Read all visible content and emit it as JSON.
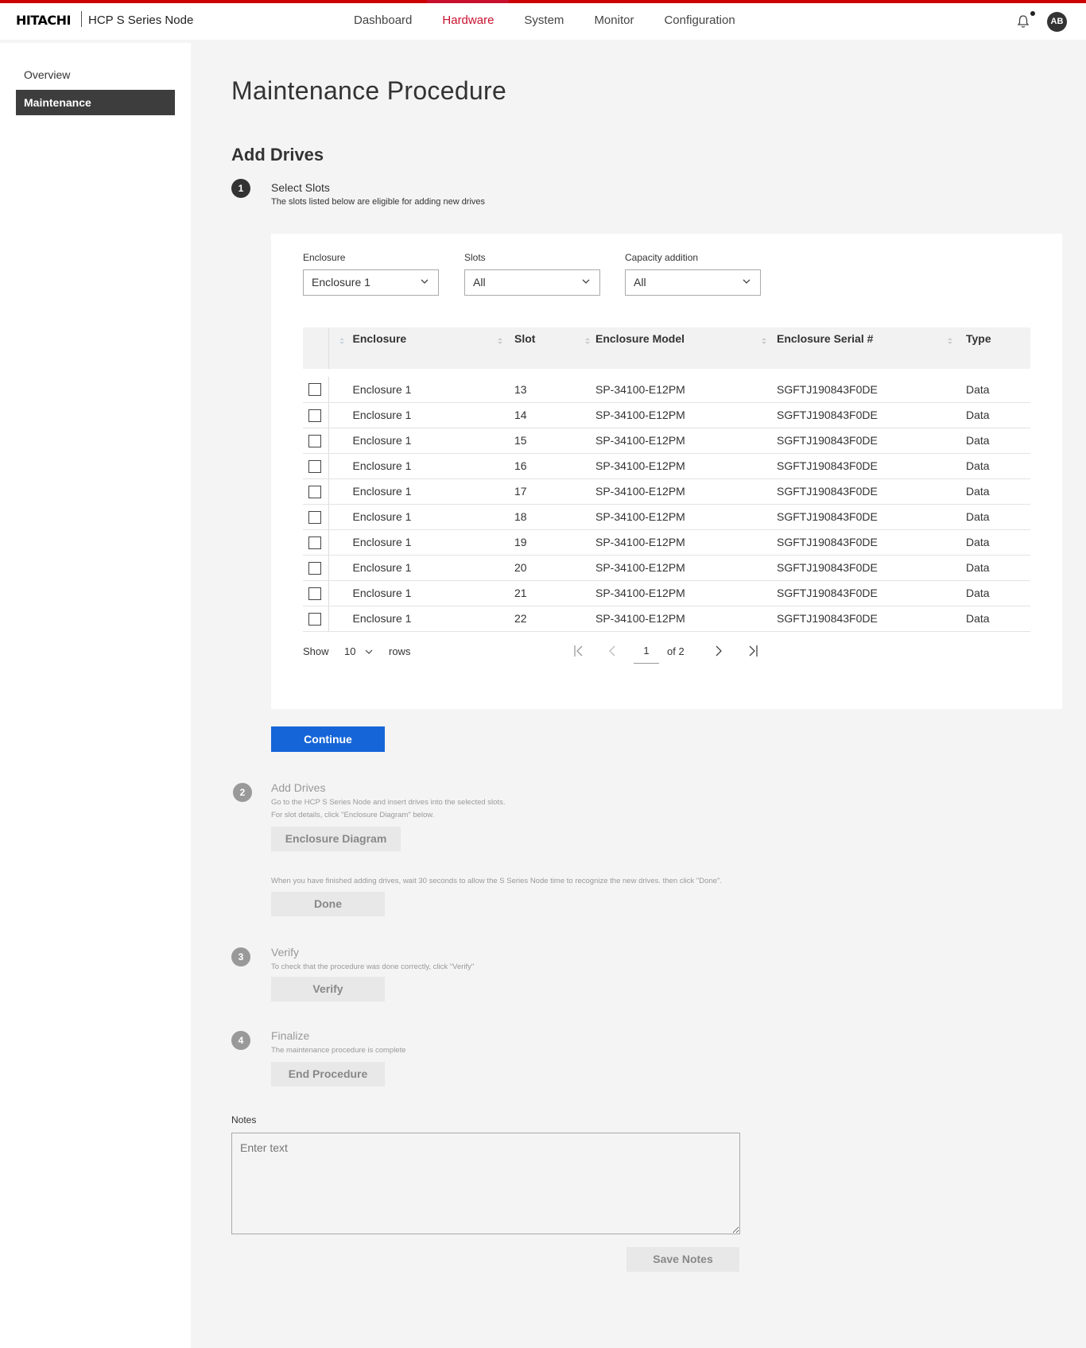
{
  "header": {
    "brand": "HITACHI",
    "product": "HCP S Series Node",
    "nav": [
      "Dashboard",
      "Hardware",
      "System",
      "Monitor",
      "Configuration"
    ],
    "active_nav": "Hardware",
    "avatar_initials": "AB",
    "accent_color": "#c8102e"
  },
  "sidebar": {
    "items": [
      {
        "label": "Overview"
      },
      {
        "label": "Maintenance"
      }
    ]
  },
  "main": {
    "title": "Maintenance Procedure",
    "section": "Add Drives",
    "steps": [
      {
        "number": "1",
        "title": "Select Slots",
        "desc": "The slots listed below are eligible for adding new drives"
      },
      {
        "number": "2",
        "title": "Add Drives",
        "desc1": "Go to the HCP S Series Node and insert drives into the selected slots.",
        "desc2": "For slot details, click \"Enclosure Diagram\" below.",
        "button": "Enclosure Diagram",
        "desc3": "When you have finished adding drives, wait 30 seconds to allow the S Series Node time to recognize the new drives. then click \"Done\".",
        "button2": "Done"
      },
      {
        "number": "3",
        "title": "Verify",
        "desc": "To check that the procedure was done correctly, click \"Verify\"",
        "button": "Verify"
      },
      {
        "number": "4",
        "title": "Finalize",
        "desc": "The maintenance procedure is complete",
        "button": "End Procedure"
      }
    ],
    "filters": {
      "enclosure": {
        "label": "Enclosure",
        "value": "Enclosure 1"
      },
      "slots": {
        "label": "Slots",
        "value": "All"
      },
      "capacity": {
        "label": "Capacity addition",
        "value": "All"
      }
    },
    "table": {
      "columns": [
        "Enclosure",
        "Slot",
        "Enclosure Model",
        "Enclosure Serial #",
        "Type"
      ],
      "rows": [
        [
          "Enclosure 1",
          "13",
          "SP-34100-E12PM",
          "SGFTJ190843F0DE",
          "Data"
        ],
        [
          "Enclosure 1",
          "14",
          "SP-34100-E12PM",
          "SGFTJ190843F0DE",
          "Data"
        ],
        [
          "Enclosure 1",
          "15",
          "SP-34100-E12PM",
          "SGFTJ190843F0DE",
          "Data"
        ],
        [
          "Enclosure 1",
          "16",
          "SP-34100-E12PM",
          "SGFTJ190843F0DE",
          "Data"
        ],
        [
          "Enclosure 1",
          "17",
          "SP-34100-E12PM",
          "SGFTJ190843F0DE",
          "Data"
        ],
        [
          "Enclosure 1",
          "18",
          "SP-34100-E12PM",
          "SGFTJ190843F0DE",
          "Data"
        ],
        [
          "Enclosure 1",
          "19",
          "SP-34100-E12PM",
          "SGFTJ190843F0DE",
          "Data"
        ],
        [
          "Enclosure 1",
          "20",
          "SP-34100-E12PM",
          "SGFTJ190843F0DE",
          "Data"
        ],
        [
          "Enclosure 1",
          "21",
          "SP-34100-E12PM",
          "SGFTJ190843F0DE",
          "Data"
        ],
        [
          "Enclosure 1",
          "22",
          "SP-34100-E12PM",
          "SGFTJ190843F0DE",
          "Data"
        ]
      ]
    },
    "pagination": {
      "show_label": "Show",
      "rows_per_page": "10",
      "rows_label": "rows",
      "current_page": "1",
      "of_label": "of 2"
    },
    "continue_button": "Continue",
    "notes": {
      "label": "Notes",
      "placeholder": "Enter text",
      "save_button": "Save Notes"
    }
  }
}
